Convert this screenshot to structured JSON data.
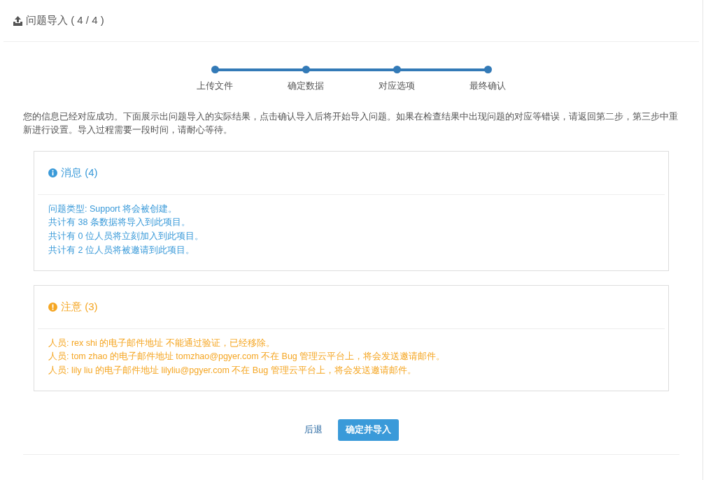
{
  "header": {
    "title": "问题导入 ( 4 / 4 )"
  },
  "steps": [
    {
      "label": "上传文件",
      "done": true
    },
    {
      "label": "确定数据",
      "done": true
    },
    {
      "label": "对应选项",
      "done": true
    },
    {
      "label": "最终确认",
      "done": true
    }
  ],
  "description": "您的信息已经对应成功。下面展示出问题导入的实际结果，点击确认导入后将开始导入问题。如果在检查结果中出现问题的对应等错误，请返回第二步，第三步中重新进行设置。导入过程需要一段时间，请耐心等待。",
  "panels": [
    {
      "kind": "info",
      "title": "消息 (4)",
      "lines": [
        "问题类型: Support 将会被创建。",
        "共计有 38 条数据将导入到此项目。",
        "共计有 0 位人员将立刻加入到此项目。",
        "共计有 2 位人员将被邀请到此项目。"
      ]
    },
    {
      "kind": "warning",
      "title": "注意 (3)",
      "lines": [
        "人员: rex shi 的电子邮件地址 不能通过验证，已经移除。",
        "人员: tom zhao 的电子邮件地址 tomzhao@pgyer.com 不在 Bug 管理云平台上，将会发送邀请邮件。",
        "人员: lily liu 的电子邮件地址 lilyliu@pgyer.com 不在 Bug 管理云平台上，将会发送邀请邮件。"
      ]
    }
  ],
  "buttons": {
    "back": "后退",
    "confirm": "确定并导入"
  }
}
